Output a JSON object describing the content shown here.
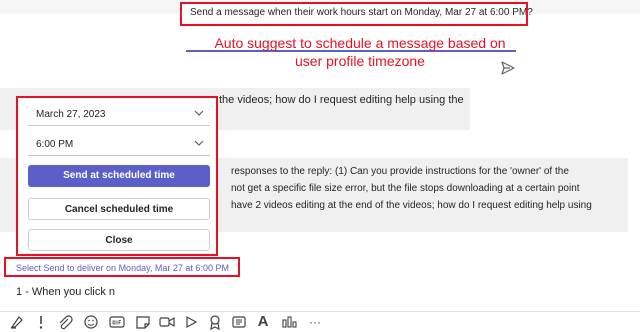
{
  "suggestion": {
    "text": "Send a message when their work hours start on Monday, Mar 27 at 6:00 PM?"
  },
  "annotation": {
    "text": "Auto suggest to schedule a message based on user profile timezone"
  },
  "messages": {
    "first": "the videos; how do I request editing help using the",
    "second": [
      "responses to the reply: (1) Can you provide instructions for the 'owner' of the",
      "not get a specific file size error, but the file stops downloading at a certain point",
      "have 2 videos editing at the end of the videos; how do I request editing help using"
    ]
  },
  "schedule": {
    "date": "March 27, 2023",
    "time": "6:00 PM",
    "send_label": "Send at scheduled time",
    "cancel_label": "Cancel scheduled time",
    "close_label": "Close"
  },
  "hint": {
    "text": "Select Send to deliver on Monday, Mar 27 at 6:00 PM"
  },
  "composer": {
    "text": "1 - When you click n"
  },
  "toolbar": {
    "icons": [
      "format-icon",
      "priority-icon",
      "attach-icon",
      "emoji-icon",
      "gif-icon",
      "sticker-icon",
      "meet-icon",
      "stream-icon",
      "praise-icon",
      "loop-icon",
      "text-format-icon",
      "apps-icon",
      "more-icon"
    ],
    "text_format_glyph": "A",
    "more_glyph": "···"
  },
  "colors": {
    "accent": "#5b5fc7",
    "annotation": "#e81123"
  }
}
